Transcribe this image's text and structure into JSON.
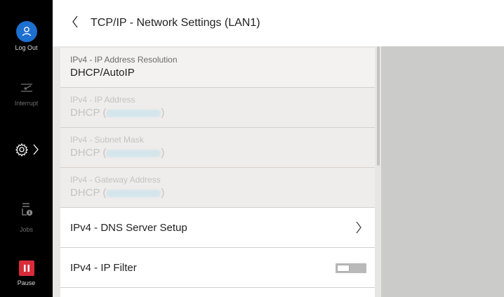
{
  "rail": {
    "logout_label": "Log Out",
    "interrupt_label": "Interrupt",
    "jobs_label": "Jobs",
    "pause_label": "Pause"
  },
  "header": {
    "title": "TCP/IP - Network Settings (LAN1)"
  },
  "rows": [
    {
      "label": "IPv4 - IP Address Resolution",
      "value": "DHCP/AutoIP"
    },
    {
      "label": "IPv4 - IP Address",
      "value_prefix": "DHCP (",
      "value_suffix": ")"
    },
    {
      "label": "IPv4 - Subnet Mask",
      "value_prefix": "DHCP (",
      "value_suffix": ")"
    },
    {
      "label": "IPv4 - Gateway Address",
      "value_prefix": "DHCP (",
      "value_suffix": ")"
    }
  ],
  "dns_label": "IPv4 - DNS Server Setup",
  "filter_label": "IPv4 - IP Filter",
  "filter_toggle_state": "off",
  "colors": {
    "accent_blue": "#1d6fd0",
    "pause_red": "#d92b3a"
  }
}
